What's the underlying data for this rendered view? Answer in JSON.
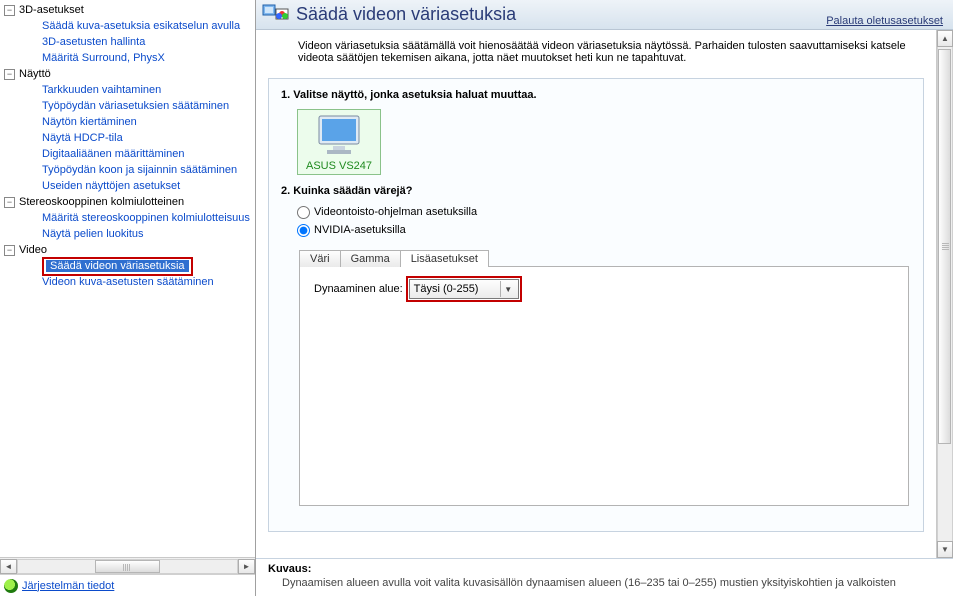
{
  "sidebar": {
    "groups": [
      {
        "label": "3D-asetukset",
        "items": [
          "Säädä kuva-asetuksia esikatselun avulla",
          "3D-asetusten hallinta",
          "Määritä Surround, PhysX"
        ]
      },
      {
        "label": "Näyttö",
        "items": [
          "Tarkkuuden vaihtaminen",
          "Työpöydän väriasetuksien säätäminen",
          "Näytön kiertäminen",
          "Näytä HDCP-tila",
          "Digitaaliäänen määrittäminen",
          "Työpöydän koon ja sijainnin säätäminen",
          "Useiden näyttöjen asetukset"
        ]
      },
      {
        "label": "Stereoskooppinen kolmiulotteinen",
        "items": [
          "Määritä stereoskooppinen kolmiulotteisuus",
          "Näytä pelien luokitus"
        ]
      },
      {
        "label": "Video",
        "items": [
          "Säädä videon väriasetuksia",
          "Videon kuva-asetusten säätäminen"
        ]
      }
    ],
    "selected": "Säädä videon väriasetuksia",
    "sysinfo": "Järjestelmän tiedot"
  },
  "header": {
    "title": "Säädä videon väriasetuksia",
    "restore": "Palauta oletusasetukset"
  },
  "desc": "Videon väriasetuksia säätämällä voit hienosäätää videon väriasetuksia näytössä. Parhaiden tulosten saavuttamiseksi katsele videota säätöjen tekemisen aikana, jotta näet muutokset heti kun ne tapahtuvat.",
  "step1": {
    "label": "1. Valitse näyttö, jonka asetuksia haluat muuttaa.",
    "monitor": "ASUS VS247"
  },
  "step2": {
    "label": "2. Kuinka säädän värejä?",
    "radios": {
      "player": "Videontoisto-ohjelman asetuksilla",
      "nvidia": "NVIDIA-asetuksilla"
    }
  },
  "tabs": {
    "color": "Väri",
    "gamma": "Gamma",
    "advanced": "Lisäasetukset"
  },
  "adv": {
    "range_label": "Dynaaminen alue:",
    "range_value": "Täysi (0-255)"
  },
  "footer": {
    "label": "Kuvaus:",
    "text": "Dynaamisen alueen avulla voit valita kuvasisällön dynaamisen alueen (16–235 tai 0–255) mustien yksityiskohtien ja valkoisten"
  }
}
